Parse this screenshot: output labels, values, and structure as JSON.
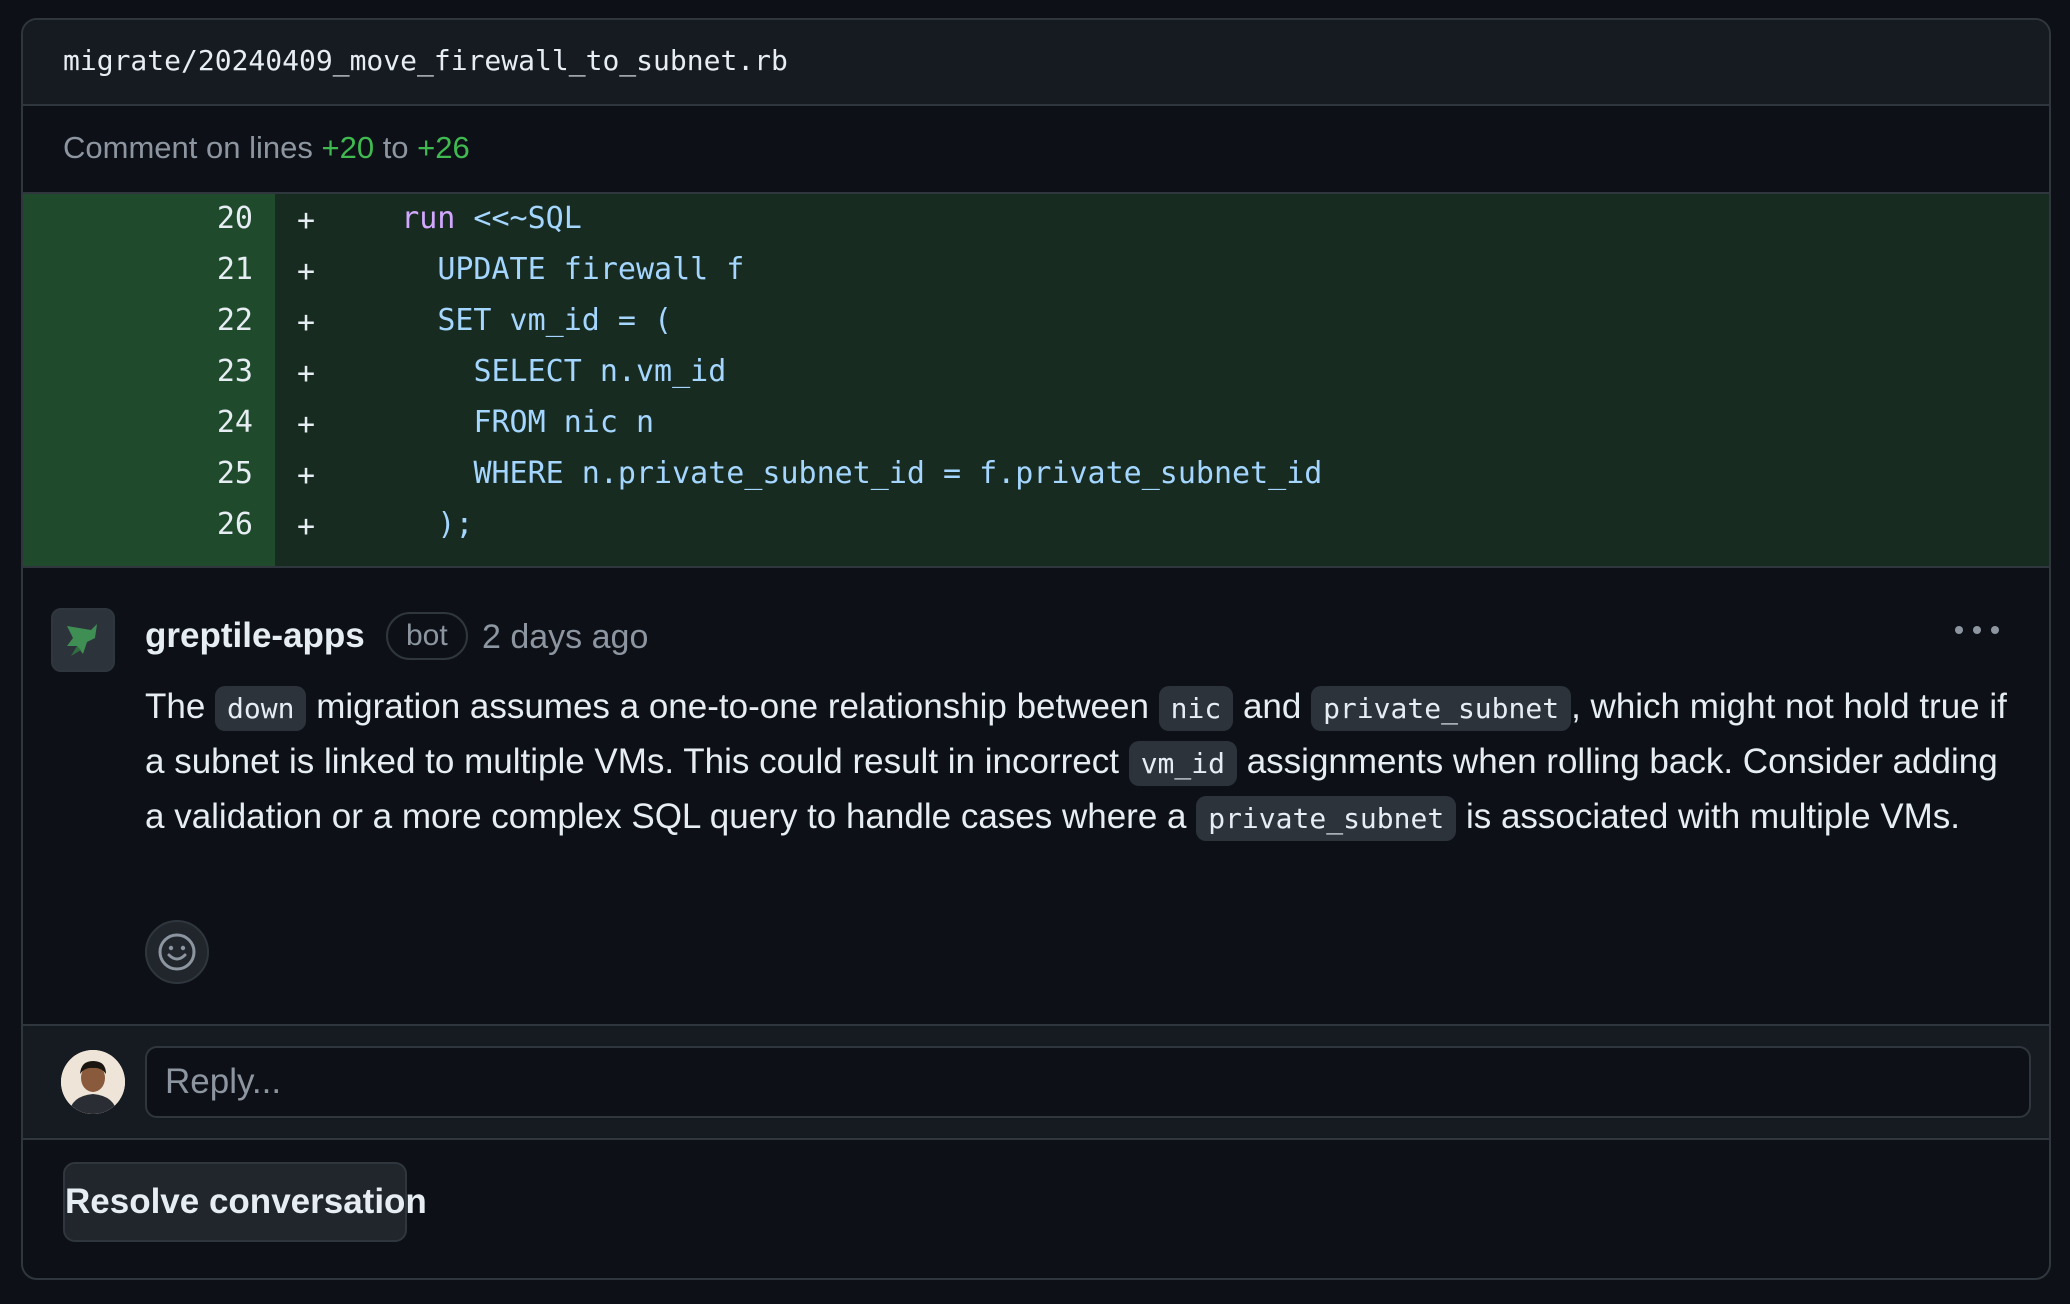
{
  "file": {
    "name": "migrate/20240409_move_firewall_to_subnet.rb"
  },
  "comment_range": {
    "prefix": "Comment on lines",
    "start": "+20",
    "middle": "to",
    "end": "+26"
  },
  "diff": {
    "lines": [
      {
        "num": "20",
        "marker": "+",
        "kw": "run",
        "rest": " <<~SQL",
        "indent": "   "
      },
      {
        "num": "21",
        "marker": "+",
        "kw": "",
        "rest": "UPDATE firewall f",
        "indent": "     "
      },
      {
        "num": "22",
        "marker": "+",
        "kw": "",
        "rest": "SET vm_id = (",
        "indent": "     "
      },
      {
        "num": "23",
        "marker": "+",
        "kw": "",
        "rest": "SELECT n.vm_id",
        "indent": "       "
      },
      {
        "num": "24",
        "marker": "+",
        "kw": "",
        "rest": "FROM nic n",
        "indent": "       "
      },
      {
        "num": "25",
        "marker": "+",
        "kw": "",
        "rest": "WHERE n.private_subnet_id = f.private_subnet_id",
        "indent": "       "
      },
      {
        "num": "26",
        "marker": "+",
        "kw": "",
        "rest": ");",
        "indent": "     "
      }
    ]
  },
  "comment": {
    "author": "greptile-apps",
    "badge": "bot",
    "time": "2 days ago",
    "body": {
      "t1": "The ",
      "c1": "down",
      "t2": " migration assumes a one-to-one relationship between ",
      "c2": "nic",
      "t3": " and ",
      "c3": "private_subnet",
      "t4": ", which might not hold true if a subnet is linked to multiple VMs. This could result in incorrect ",
      "c4": "vm_id",
      "t5": " assignments when rolling back. Consider adding a validation or a more complex SQL query to handle cases where a ",
      "c5": "private_subnet",
      "t6": " is associated with multiple VMs."
    },
    "more_icon": "kebab-horizontal-icon",
    "emoji_icon": "smiley-icon"
  },
  "reply": {
    "placeholder": "Reply..."
  },
  "actions": {
    "resolve_label": "Resolve conversation"
  },
  "colors": {
    "background": "#0d1117",
    "added_line": "#172b21",
    "added_gutter": "#1f4a2c",
    "addition_text": "#3fb950",
    "muted": "#8d96a0"
  }
}
